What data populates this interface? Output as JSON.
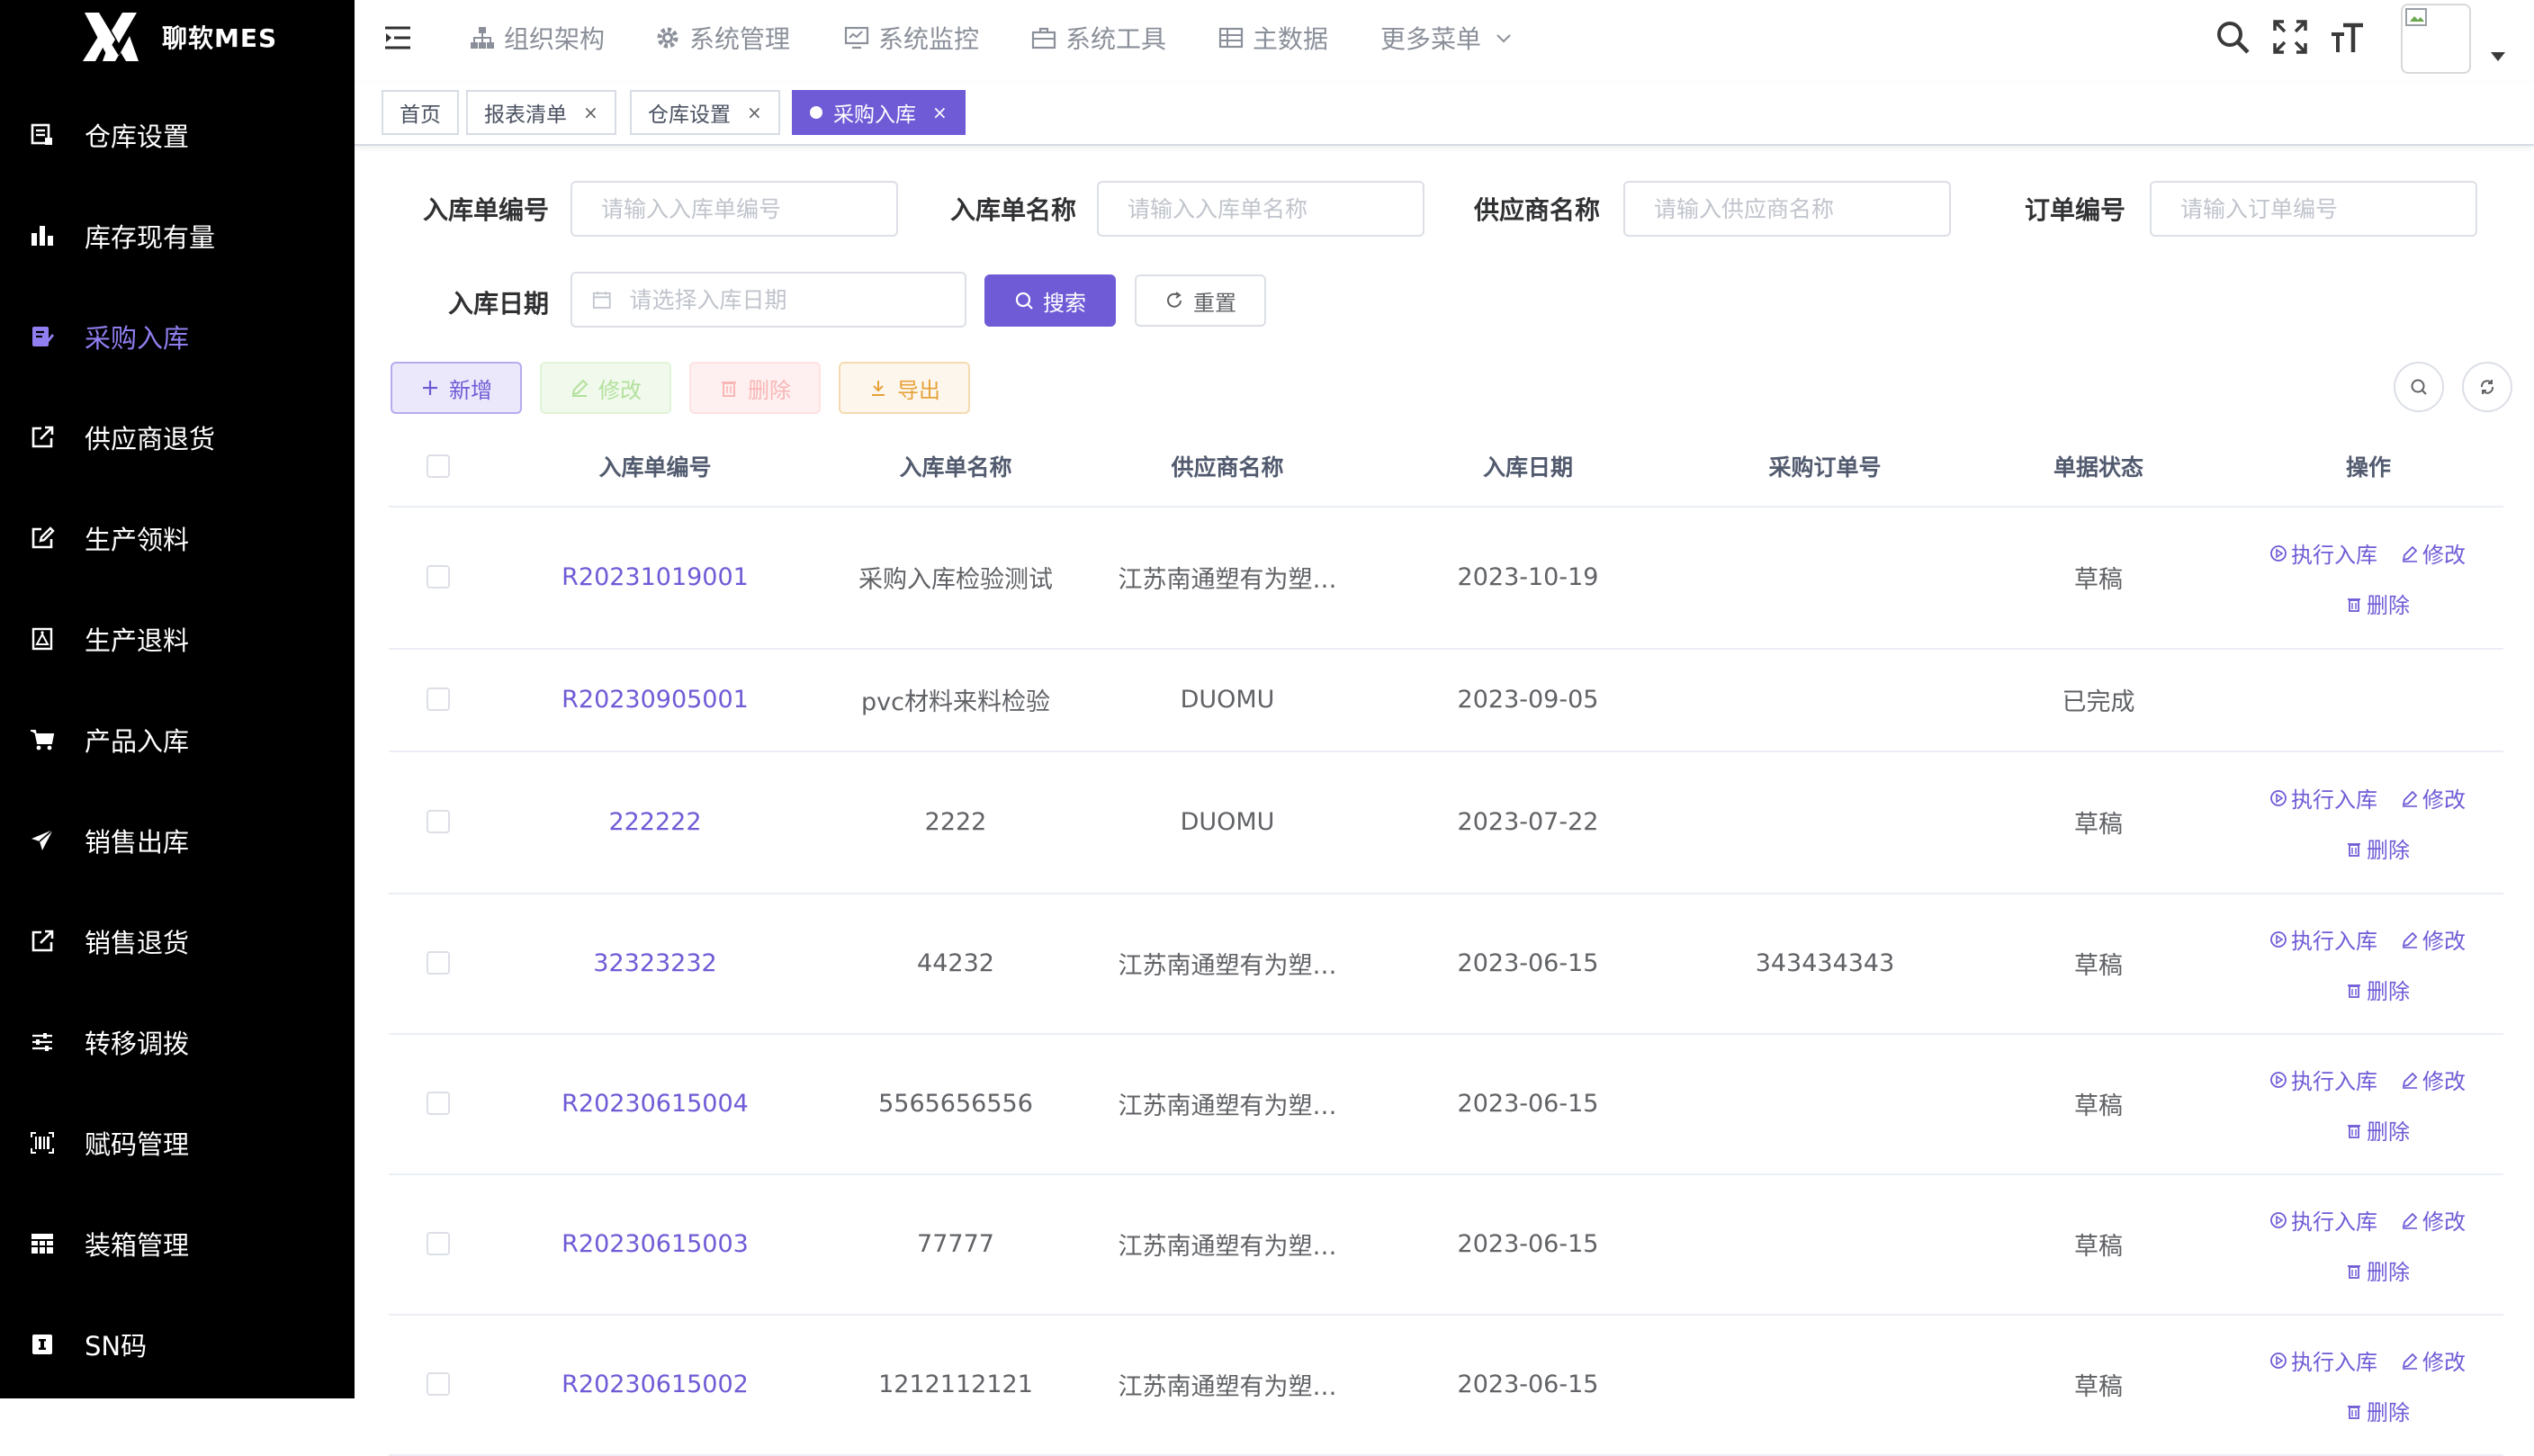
{
  "app": {
    "title": "聊软MES"
  },
  "sidebar": {
    "items": [
      {
        "label": "仓库设置",
        "icon": "warehouse-icon"
      },
      {
        "label": "库存现有量",
        "icon": "bar-chart-icon"
      },
      {
        "label": "采购入库",
        "icon": "purchase-edit-icon",
        "active": true
      },
      {
        "label": "供应商退货",
        "icon": "external-link-icon"
      },
      {
        "label": "生产领料",
        "icon": "edit-icon"
      },
      {
        "label": "生产退料",
        "icon": "photo-frame-icon"
      },
      {
        "label": "产品入库",
        "icon": "shopping-cart-icon"
      },
      {
        "label": "销售出库",
        "icon": "paper-plane-icon"
      },
      {
        "label": "销售退货",
        "icon": "external-link-icon"
      },
      {
        "label": "转移调拨",
        "icon": "sliders-icon"
      },
      {
        "label": "赋码管理",
        "icon": "barcode-icon"
      },
      {
        "label": "装箱管理",
        "icon": "table-grid-icon"
      },
      {
        "label": "SN码",
        "icon": "sn-badge-icon"
      }
    ]
  },
  "topnav": {
    "items": [
      {
        "label": "组织架构",
        "icon": "org-tree-icon"
      },
      {
        "label": "系统管理",
        "icon": "gear-icon"
      },
      {
        "label": "系统监控",
        "icon": "monitor-icon"
      },
      {
        "label": "系统工具",
        "icon": "toolbox-icon"
      },
      {
        "label": "主数据",
        "icon": "grid-table-icon"
      },
      {
        "label": "更多菜单",
        "icon": "chevron-down-icon"
      }
    ]
  },
  "tags": [
    {
      "label": "首页",
      "closable": false
    },
    {
      "label": "报表清单",
      "closable": true
    },
    {
      "label": "仓库设置",
      "closable": true
    },
    {
      "label": "采购入库",
      "closable": true,
      "active": true
    }
  ],
  "search": {
    "fields": [
      {
        "label": "入库单编号",
        "placeholder": "请输入入库单编号"
      },
      {
        "label": "入库单名称",
        "placeholder": "请输入入库单名称"
      },
      {
        "label": "供应商名称",
        "placeholder": "请输入供应商名称"
      },
      {
        "label": "订单编号",
        "placeholder": "请输入订单编号"
      },
      {
        "label": "入库日期",
        "placeholder": "请选择入库日期"
      }
    ],
    "search_label": "搜索",
    "reset_label": "重置"
  },
  "toolbar": {
    "add_label": "新增",
    "edit_label": "修改",
    "delete_label": "删除",
    "export_label": "导出"
  },
  "table": {
    "columns": [
      "入库单编号",
      "入库单名称",
      "供应商名称",
      "入库日期",
      "采购订单号",
      "单据状态",
      "操作"
    ],
    "actions": {
      "execute": "执行入库",
      "edit": "修改",
      "delete": "删除"
    },
    "rows": [
      {
        "code": "R20231019001",
        "name": "采购入库检验测试",
        "vendor": "江苏南通塑有为塑…",
        "date": "2023-10-19",
        "po": "",
        "status": "草稿"
      },
      {
        "code": "R20230905001",
        "name": "pvc材料来料检验",
        "vendor": "DUOMU",
        "date": "2023-09-05",
        "po": "",
        "status": "已完成"
      },
      {
        "code": "222222",
        "name": "2222",
        "vendor": "DUOMU",
        "date": "2023-07-22",
        "po": "",
        "status": "草稿"
      },
      {
        "code": "32323232",
        "name": "44232",
        "vendor": "江苏南通塑有为塑…",
        "date": "2023-06-15",
        "po": "343434343",
        "status": "草稿"
      },
      {
        "code": "R20230615004",
        "name": "5565656556",
        "vendor": "江苏南通塑有为塑…",
        "date": "2023-06-15",
        "po": "",
        "status": "草稿"
      },
      {
        "code": "R20230615003",
        "name": "77777",
        "vendor": "江苏南通塑有为塑…",
        "date": "2023-06-15",
        "po": "",
        "status": "草稿"
      },
      {
        "code": "R20230615002",
        "name": "1212112121",
        "vendor": "江苏南通塑有为塑…",
        "date": "2023-06-15",
        "po": "",
        "status": "草稿"
      }
    ]
  },
  "colors": {
    "accent": "#6f5bd6",
    "sidebar_bg": "#000000",
    "success": "#b3e19d",
    "danger": "#fab6b6",
    "warning": "#e6a23c"
  }
}
